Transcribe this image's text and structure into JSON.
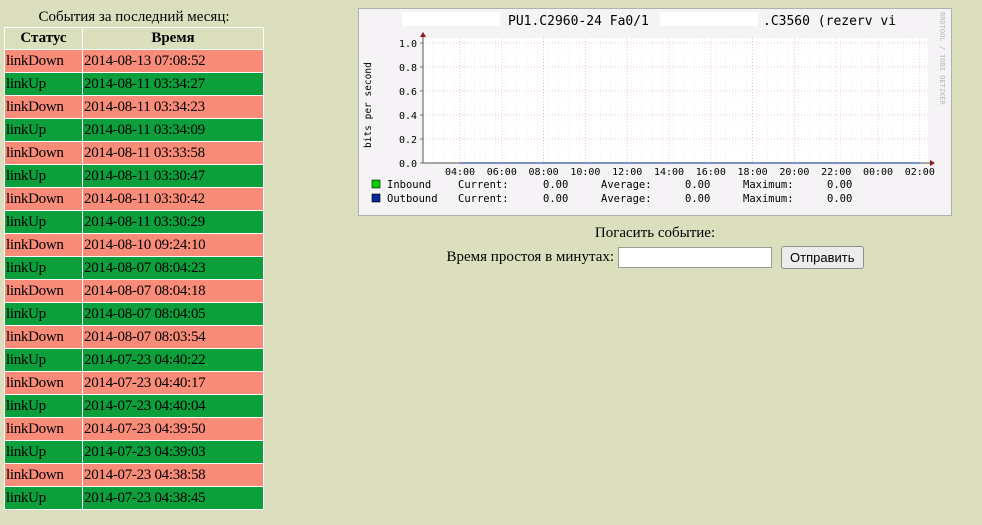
{
  "events": {
    "caption": "События за последний месяц:",
    "headers": {
      "status": "Статус",
      "time": "Время"
    },
    "rows": [
      {
        "status": "linkDown",
        "time": "2014-08-13 07:08:52"
      },
      {
        "status": "linkUp",
        "time": "2014-08-11 03:34:27"
      },
      {
        "status": "linkDown",
        "time": "2014-08-11 03:34:23"
      },
      {
        "status": "linkUp",
        "time": "2014-08-11 03:34:09"
      },
      {
        "status": "linkDown",
        "time": "2014-08-11 03:33:58"
      },
      {
        "status": "linkUp",
        "time": "2014-08-11 03:30:47"
      },
      {
        "status": "linkDown",
        "time": "2014-08-11 03:30:42"
      },
      {
        "status": "linkUp",
        "time": "2014-08-11 03:30:29"
      },
      {
        "status": "linkDown",
        "time": "2014-08-10 09:24:10"
      },
      {
        "status": "linkUp",
        "time": "2014-08-07 08:04:23"
      },
      {
        "status": "linkDown",
        "time": "2014-08-07 08:04:18"
      },
      {
        "status": "linkUp",
        "time": "2014-08-07 08:04:05"
      },
      {
        "status": "linkDown",
        "time": "2014-08-07 08:03:54"
      },
      {
        "status": "linkUp",
        "time": "2014-07-23 04:40:22"
      },
      {
        "status": "linkDown",
        "time": "2014-07-23 04:40:17"
      },
      {
        "status": "linkUp",
        "time": "2014-07-23 04:40:04"
      },
      {
        "status": "linkDown",
        "time": "2014-07-23 04:39:50"
      },
      {
        "status": "linkUp",
        "time": "2014-07-23 04:39:03"
      },
      {
        "status": "linkDown",
        "time": "2014-07-23 04:38:58"
      },
      {
        "status": "linkUp",
        "time": "2014-07-23 04:38:45"
      }
    ],
    "colors": {
      "linkDown": "#f98b79",
      "linkUp": "#0d9f3c"
    }
  },
  "graph": {
    "title_part1": "PU1.C2960-24 Fa0/1",
    "title_part2": ".C3560 (rezerv vi",
    "watermark": "RRDTOOL / TOBI OETIKER",
    "colors": {
      "inbound": "#00cc00",
      "outbound": "#002a97",
      "canvas": "#ffffff",
      "frame": "#f5f3f5"
    }
  },
  "chart_data": {
    "type": "line",
    "ylabel": "bits per second",
    "ylim": [
      0,
      1.0
    ],
    "yticks": [
      "0.0",
      "0.2",
      "0.4",
      "0.6",
      "0.8",
      "1.0"
    ],
    "xticks": [
      "04:00",
      "06:00",
      "08:00",
      "10:00",
      "12:00",
      "14:00",
      "16:00",
      "18:00",
      "20:00",
      "22:00",
      "00:00",
      "02:00"
    ],
    "grid": true,
    "series": [
      {
        "name": "Inbound",
        "values": [
          0,
          0,
          0,
          0,
          0,
          0,
          0,
          0,
          0,
          0,
          0,
          0
        ]
      },
      {
        "name": "Outbound",
        "values": [
          0,
          0,
          0,
          0,
          0,
          0,
          0,
          0,
          0,
          0,
          0,
          0
        ]
      }
    ],
    "legend": [
      {
        "name": "Inbound",
        "current_label": "Current:",
        "current": "0.00",
        "average_label": "Average:",
        "average": "0.00",
        "maximum_label": "Maximum:",
        "maximum": "0.00"
      },
      {
        "name": "Outbound",
        "current_label": "Current:",
        "current": "0.00",
        "average_label": "Average:",
        "average": "0.00",
        "maximum_label": "Maximum:",
        "maximum": "0.00"
      }
    ]
  },
  "action": {
    "title": "Погасить событие:",
    "downtime_label": "Время простоя в минутах:",
    "downtime_value": "",
    "submit_label": "Отправить"
  }
}
